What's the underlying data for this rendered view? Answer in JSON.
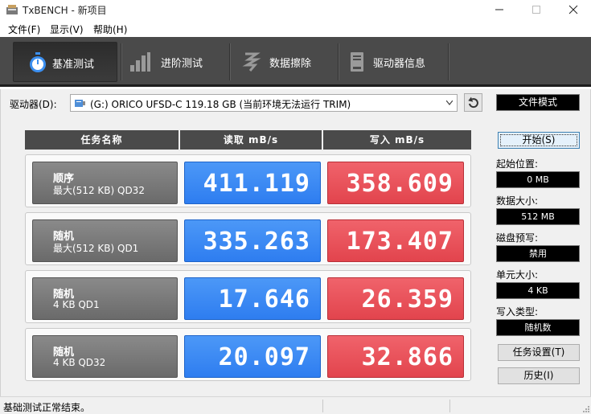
{
  "window": {
    "title": "TxBENCH - 新项目"
  },
  "menu": {
    "items": [
      "文件(F)",
      "显示(V)",
      "帮助(H)"
    ]
  },
  "toolbar": {
    "tabs": [
      {
        "label": "基准测试",
        "icon": "stopwatch-icon",
        "active": true
      },
      {
        "label": "进阶测试",
        "icon": "bar-chart-icon",
        "active": false
      },
      {
        "label": "数据擦除",
        "icon": "eraser-icon",
        "active": false
      },
      {
        "label": "驱动器信息",
        "icon": "drive-info-icon",
        "active": false
      }
    ]
  },
  "drive": {
    "label": "驱动器(D):",
    "selected": "(G:) ORICO UFSD-C  119.18 GB (当前环境无法运行 TRIM)",
    "mode": "文件模式"
  },
  "table": {
    "headers": [
      "任务名称",
      "读取 mB/s",
      "写入 mB/s"
    ],
    "rows": [
      {
        "name": "顺序",
        "detail": "最大(512 KB) QD32",
        "read": "411.119",
        "write": "358.609"
      },
      {
        "name": "随机",
        "detail": "最大(512 KB) QD1",
        "read": "335.263",
        "write": "173.407"
      },
      {
        "name": "随机",
        "detail": "4 KB QD1",
        "read": "17.646",
        "write": "26.359"
      },
      {
        "name": "随机",
        "detail": "4 KB QD32",
        "read": "20.097",
        "write": "32.866"
      }
    ]
  },
  "side": {
    "start_label": "开始(S)",
    "start_pos_label": "起始位置:",
    "start_pos_value": "0 MB",
    "data_size_label": "数据大小:",
    "data_size_value": "512 MB",
    "precondition_label": "磁盘预写:",
    "precondition_value": "禁用",
    "unit_size_label": "单元大小:",
    "unit_size_value": "4 KB",
    "write_type_label": "写入类型:",
    "write_type_value": "随机数",
    "task_settings_label": "任务设置(T)",
    "history_label": "历史(I)"
  },
  "status": {
    "text": "基础测试正常结束。"
  },
  "colors": {
    "read": "#2e7df0",
    "write": "#e2444d",
    "toolbar": "#4a4a4a"
  }
}
